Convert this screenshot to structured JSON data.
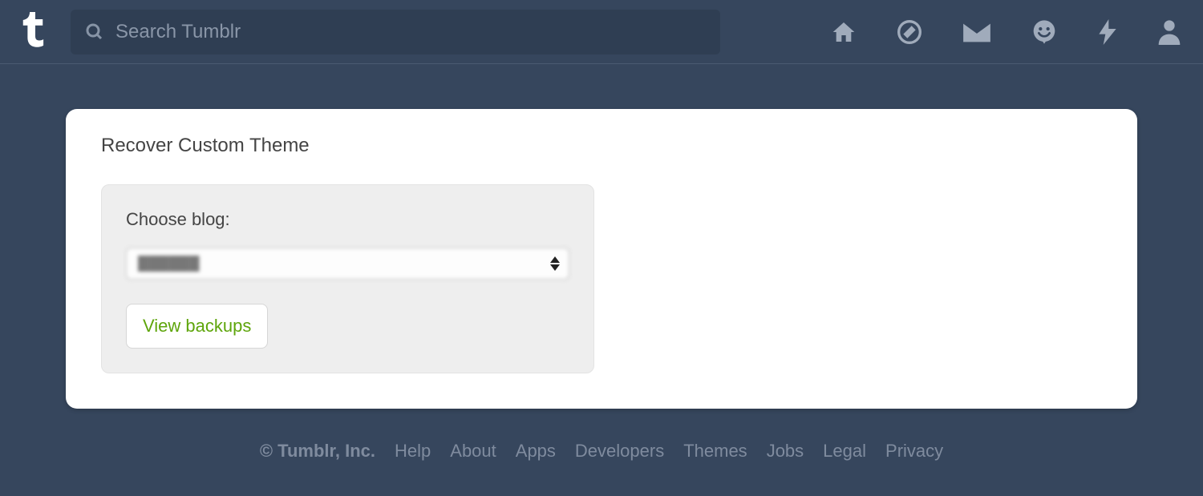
{
  "nav": {
    "search_placeholder": "Search Tumblr",
    "icons": {
      "home": "home-icon",
      "explore": "compass-icon",
      "inbox": "mail-icon",
      "messaging": "smiley-icon",
      "activity": "lightning-icon",
      "account": "person-icon"
    }
  },
  "page": {
    "title": "Recover Custom Theme",
    "panel": {
      "label": "Choose blog:",
      "selected_blog": "██████",
      "view_button": "View backups"
    }
  },
  "footer": {
    "copyright": "© Tumblr, Inc.",
    "links": [
      "Help",
      "About",
      "Apps",
      "Developers",
      "Themes",
      "Jobs",
      "Legal",
      "Privacy"
    ]
  }
}
